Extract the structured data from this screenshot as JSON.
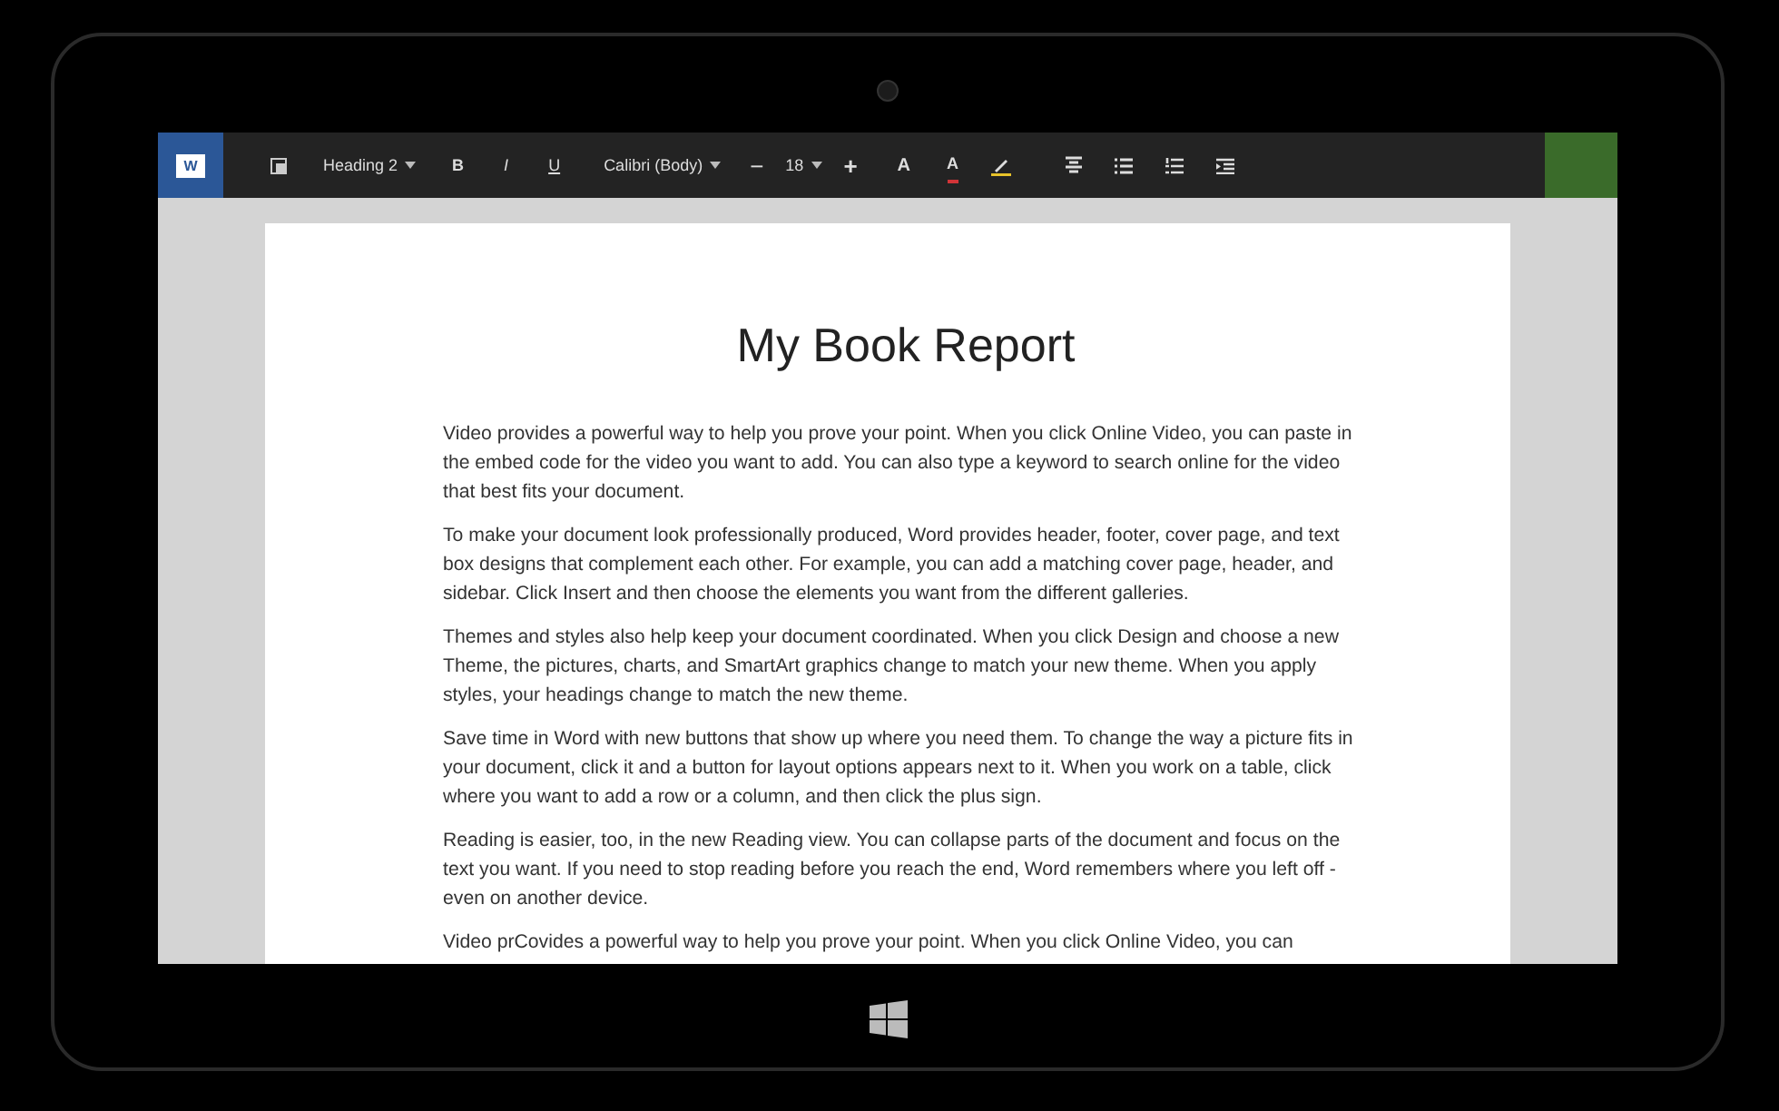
{
  "app": {
    "logo_letter": "W"
  },
  "toolbar": {
    "style": "Heading 2",
    "bold": "B",
    "italic": "I",
    "underline": "U",
    "font": "Calibri (Body)",
    "decrease": "−",
    "size": "18",
    "increase": "+",
    "grow_font": "A",
    "font_color": "A"
  },
  "document": {
    "title": "My Book Report",
    "paragraphs": [
      "Video provides a powerful way to help you prove your point. When you click Online Video, you can paste in the embed code for the video you want to add. You can also type a keyword to search online for the video that best fits your document.",
      "To make your document look professionally produced, Word provides header, footer, cover page, and text box designs that complement each other. For example, you can add a matching cover page, header, and sidebar. Click Insert and then choose the elements you want from the different galleries.",
      "Themes and styles also help keep your document coordinated. When you click Design and choose a new Theme, the pictures, charts, and SmartArt graphics change to match your new theme. When you apply styles, your headings change to match the new theme.",
      "Save time in Word with new buttons that show up where you need them. To change the way a picture fits in your document, click it and a button for layout options appears next to it. When you work on a table, click where you want to add a row or a column, and then click the plus sign.",
      "Reading is easier, too, in the new Reading view. You can collapse parts of the document and focus on the text you want. If you need to stop reading before you reach the end, Word remembers where you left off - even on another device.",
      "Video prCovides a powerful way to help you prove your point. When you click Online Video, you can"
    ]
  }
}
